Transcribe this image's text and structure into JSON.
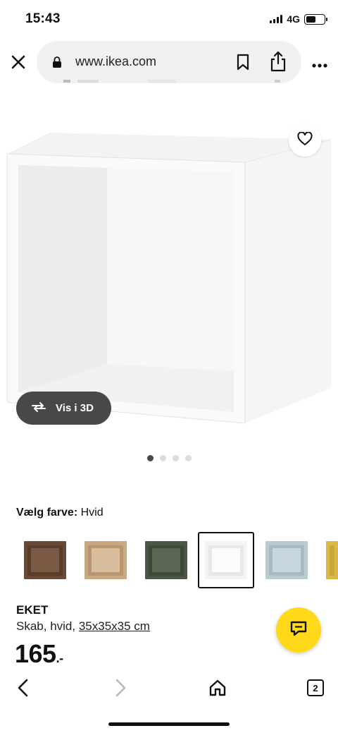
{
  "status_bar": {
    "time": "15:43",
    "network": "4G"
  },
  "browser": {
    "url": "www.ikea.com",
    "tab_count": "2",
    "icons": [
      "close-icon",
      "lock-icon",
      "bookmark-icon",
      "share-icon",
      "more-icon",
      "back-icon",
      "forward-icon",
      "home-icon",
      "tabs-icon"
    ]
  },
  "product_image": {
    "view_3d_label": "Vis i 3D",
    "carousel_total": 4,
    "carousel_active": 1
  },
  "color_selector": {
    "label": "Vælg farve:",
    "selected_value": "Hvid",
    "swatches": [
      {
        "name": "walnut",
        "outer": "#6a4a36",
        "inner": "#5a3c2a",
        "back": "#7a5a44"
      },
      {
        "name": "oak",
        "outer": "#c9a983",
        "inner": "#b9966f",
        "back": "#d8be9c"
      },
      {
        "name": "dark-green",
        "outer": "#4c5645",
        "inner": "#3f483a",
        "back": "#5a6552"
      },
      {
        "name": "white",
        "outer": "#f4f4f2",
        "inner": "#e8e8e6",
        "back": "#fbfbfb"
      },
      {
        "name": "light-blue",
        "outer": "#b9cad3",
        "inner": "#a7bac4",
        "back": "#c8d7de"
      },
      {
        "name": "yellow",
        "outer": "#d8b94a",
        "inner": "#c9a93b",
        "back": "#e2c862"
      }
    ]
  },
  "product": {
    "name": "EKET",
    "description": "Skab, hvid,",
    "size": "35x35x35 cm",
    "price": "165",
    "price_suffix": ".-"
  },
  "colors": {
    "chat_accent": "#ffd91a",
    "view3d_bg": "#484848"
  }
}
